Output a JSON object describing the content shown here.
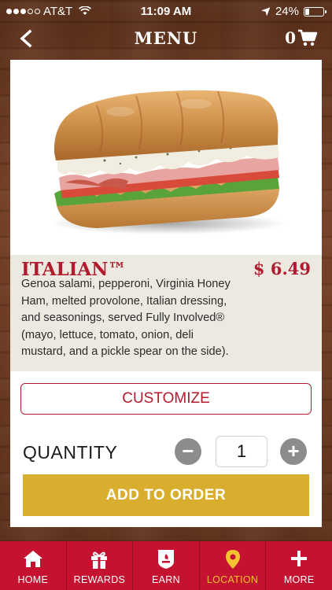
{
  "status_bar": {
    "carrier": "AT&T",
    "time": "11:09 AM",
    "battery": "24%",
    "battery_level": 0.24,
    "signal_bars": 3
  },
  "header": {
    "title": "MENU",
    "cart_count": "0"
  },
  "product": {
    "name": "ITALIAN™",
    "price": "$ 6.49",
    "description": " Genoa salami, pepperoni, Virginia Honey Ham, melted provolone, Italian dressing, and seasonings, served Fully Involved® (mayo, lettuce, tomato, onion, deli mustard, and a pickle spear on the side)."
  },
  "actions": {
    "customize_label": "CUSTOMIZE",
    "quantity_label": "QUANTITY",
    "quantity_value": "1",
    "add_label": "ADD TO ORDER"
  },
  "tabs": [
    {
      "label": "HOME",
      "icon": "home-icon",
      "active": false
    },
    {
      "label": "REWARDS",
      "icon": "gift-icon",
      "active": false
    },
    {
      "label": "EARN",
      "icon": "badge-icon",
      "active": false
    },
    {
      "label": "LOCATION",
      "icon": "location-pin-icon",
      "active": true
    },
    {
      "label": "MORE",
      "icon": "plus-icon",
      "active": false
    }
  ],
  "colors": {
    "brand_red": "#c41230",
    "title_red": "#b01b2e",
    "add_button": "#d9ae2f",
    "active_tab": "#f2c230"
  }
}
